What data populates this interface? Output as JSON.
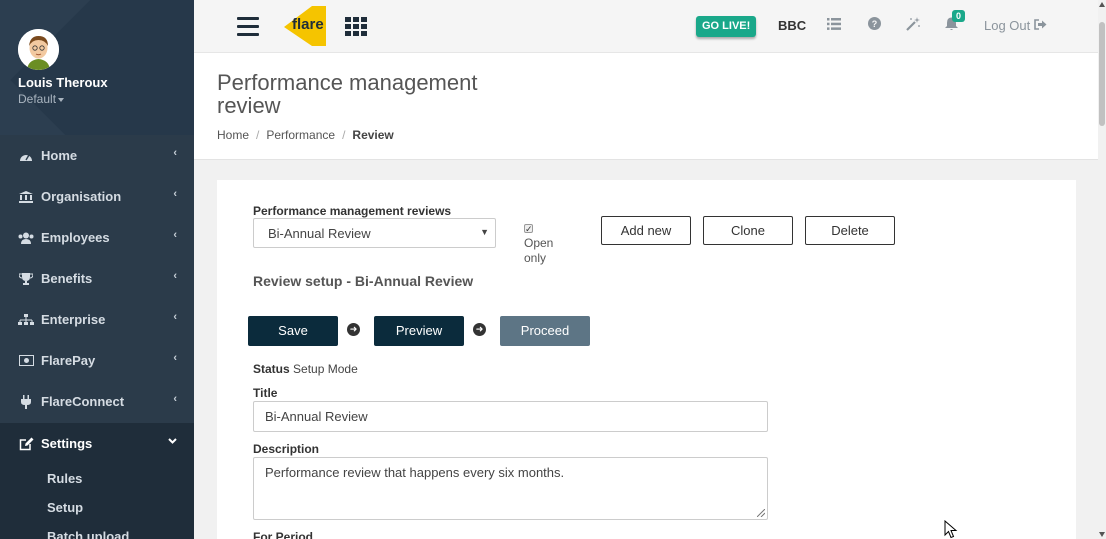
{
  "user": {
    "name": "Louis Theroux",
    "role": "Default"
  },
  "nav": [
    {
      "label": "Home",
      "icon": "dashboard-icon"
    },
    {
      "label": "Organisation",
      "icon": "bank-icon"
    },
    {
      "label": "Employees",
      "icon": "users-icon"
    },
    {
      "label": "Benefits",
      "icon": "trophy-icon"
    },
    {
      "label": "Enterprise",
      "icon": "sitemap-icon"
    },
    {
      "label": "FlarePay",
      "icon": "money-icon"
    },
    {
      "label": "FlareConnect",
      "icon": "plug-icon"
    },
    {
      "label": "Settings",
      "icon": "edit-icon",
      "active": true
    }
  ],
  "settings_sub": [
    "Rules",
    "Setup",
    "Batch upload"
  ],
  "topbar": {
    "logo_text": "flare",
    "go_live": "GO LIVE!",
    "company": "BBC",
    "notification_count": "0",
    "logout": "Log Out"
  },
  "header": {
    "title": "Performance management review",
    "breadcrumb": [
      "Home",
      "Performance",
      "Review"
    ]
  },
  "form": {
    "reviews_label": "Performance management reviews",
    "selected_review": "Bi-Annual Review",
    "open_only_label": "Open only",
    "open_only_checked": true,
    "add_new": "Add new",
    "clone": "Clone",
    "delete": "Delete",
    "section_title": "Review setup - Bi-Annual Review",
    "save": "Save",
    "preview": "Preview",
    "proceed": "Proceed",
    "status_label": "Status",
    "status_value": "Setup Mode",
    "title_label": "Title",
    "title_value": "Bi-Annual Review",
    "description_label": "Description",
    "description_value": "Performance review that happens every six months.",
    "period_label": "For Period"
  },
  "colors": {
    "sidebar": "#2b3b4a",
    "accent": "#1aa88a",
    "dark_button": "#0b2b3c",
    "logo_yellow": "#f5c400"
  }
}
